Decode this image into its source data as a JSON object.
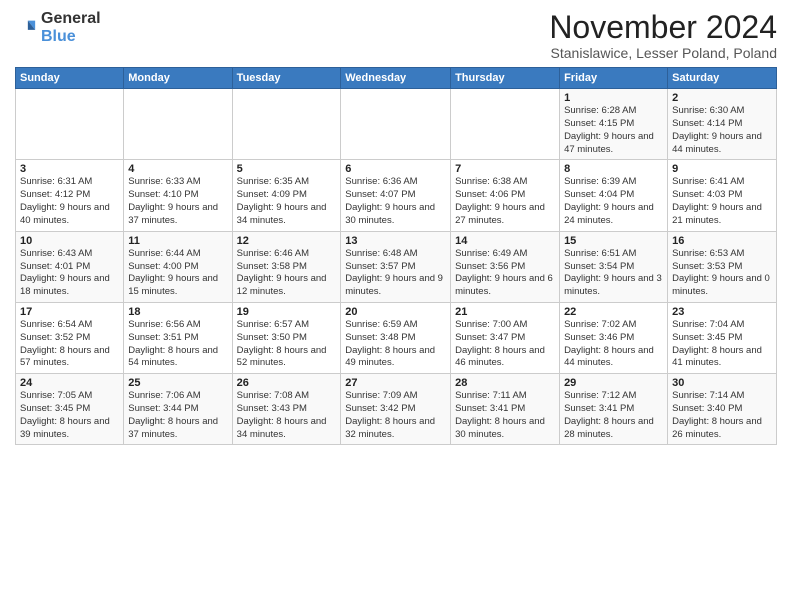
{
  "header": {
    "logo_general": "General",
    "logo_blue": "Blue",
    "month": "November 2024",
    "location": "Stanislawice, Lesser Poland, Poland"
  },
  "days_of_week": [
    "Sunday",
    "Monday",
    "Tuesday",
    "Wednesday",
    "Thursday",
    "Friday",
    "Saturday"
  ],
  "weeks": [
    [
      {
        "day": "",
        "detail": ""
      },
      {
        "day": "",
        "detail": ""
      },
      {
        "day": "",
        "detail": ""
      },
      {
        "day": "",
        "detail": ""
      },
      {
        "day": "",
        "detail": ""
      },
      {
        "day": "1",
        "detail": "Sunrise: 6:28 AM\nSunset: 4:15 PM\nDaylight: 9 hours and 47 minutes."
      },
      {
        "day": "2",
        "detail": "Sunrise: 6:30 AM\nSunset: 4:14 PM\nDaylight: 9 hours and 44 minutes."
      }
    ],
    [
      {
        "day": "3",
        "detail": "Sunrise: 6:31 AM\nSunset: 4:12 PM\nDaylight: 9 hours and 40 minutes."
      },
      {
        "day": "4",
        "detail": "Sunrise: 6:33 AM\nSunset: 4:10 PM\nDaylight: 9 hours and 37 minutes."
      },
      {
        "day": "5",
        "detail": "Sunrise: 6:35 AM\nSunset: 4:09 PM\nDaylight: 9 hours and 34 minutes."
      },
      {
        "day": "6",
        "detail": "Sunrise: 6:36 AM\nSunset: 4:07 PM\nDaylight: 9 hours and 30 minutes."
      },
      {
        "day": "7",
        "detail": "Sunrise: 6:38 AM\nSunset: 4:06 PM\nDaylight: 9 hours and 27 minutes."
      },
      {
        "day": "8",
        "detail": "Sunrise: 6:39 AM\nSunset: 4:04 PM\nDaylight: 9 hours and 24 minutes."
      },
      {
        "day": "9",
        "detail": "Sunrise: 6:41 AM\nSunset: 4:03 PM\nDaylight: 9 hours and 21 minutes."
      }
    ],
    [
      {
        "day": "10",
        "detail": "Sunrise: 6:43 AM\nSunset: 4:01 PM\nDaylight: 9 hours and 18 minutes."
      },
      {
        "day": "11",
        "detail": "Sunrise: 6:44 AM\nSunset: 4:00 PM\nDaylight: 9 hours and 15 minutes."
      },
      {
        "day": "12",
        "detail": "Sunrise: 6:46 AM\nSunset: 3:58 PM\nDaylight: 9 hours and 12 minutes."
      },
      {
        "day": "13",
        "detail": "Sunrise: 6:48 AM\nSunset: 3:57 PM\nDaylight: 9 hours and 9 minutes."
      },
      {
        "day": "14",
        "detail": "Sunrise: 6:49 AM\nSunset: 3:56 PM\nDaylight: 9 hours and 6 minutes."
      },
      {
        "day": "15",
        "detail": "Sunrise: 6:51 AM\nSunset: 3:54 PM\nDaylight: 9 hours and 3 minutes."
      },
      {
        "day": "16",
        "detail": "Sunrise: 6:53 AM\nSunset: 3:53 PM\nDaylight: 9 hours and 0 minutes."
      }
    ],
    [
      {
        "day": "17",
        "detail": "Sunrise: 6:54 AM\nSunset: 3:52 PM\nDaylight: 8 hours and 57 minutes."
      },
      {
        "day": "18",
        "detail": "Sunrise: 6:56 AM\nSunset: 3:51 PM\nDaylight: 8 hours and 54 minutes."
      },
      {
        "day": "19",
        "detail": "Sunrise: 6:57 AM\nSunset: 3:50 PM\nDaylight: 8 hours and 52 minutes."
      },
      {
        "day": "20",
        "detail": "Sunrise: 6:59 AM\nSunset: 3:48 PM\nDaylight: 8 hours and 49 minutes."
      },
      {
        "day": "21",
        "detail": "Sunrise: 7:00 AM\nSunset: 3:47 PM\nDaylight: 8 hours and 46 minutes."
      },
      {
        "day": "22",
        "detail": "Sunrise: 7:02 AM\nSunset: 3:46 PM\nDaylight: 8 hours and 44 minutes."
      },
      {
        "day": "23",
        "detail": "Sunrise: 7:04 AM\nSunset: 3:45 PM\nDaylight: 8 hours and 41 minutes."
      }
    ],
    [
      {
        "day": "24",
        "detail": "Sunrise: 7:05 AM\nSunset: 3:45 PM\nDaylight: 8 hours and 39 minutes."
      },
      {
        "day": "25",
        "detail": "Sunrise: 7:06 AM\nSunset: 3:44 PM\nDaylight: 8 hours and 37 minutes."
      },
      {
        "day": "26",
        "detail": "Sunrise: 7:08 AM\nSunset: 3:43 PM\nDaylight: 8 hours and 34 minutes."
      },
      {
        "day": "27",
        "detail": "Sunrise: 7:09 AM\nSunset: 3:42 PM\nDaylight: 8 hours and 32 minutes."
      },
      {
        "day": "28",
        "detail": "Sunrise: 7:11 AM\nSunset: 3:41 PM\nDaylight: 8 hours and 30 minutes."
      },
      {
        "day": "29",
        "detail": "Sunrise: 7:12 AM\nSunset: 3:41 PM\nDaylight: 8 hours and 28 minutes."
      },
      {
        "day": "30",
        "detail": "Sunrise: 7:14 AM\nSunset: 3:40 PM\nDaylight: 8 hours and 26 minutes."
      }
    ]
  ]
}
